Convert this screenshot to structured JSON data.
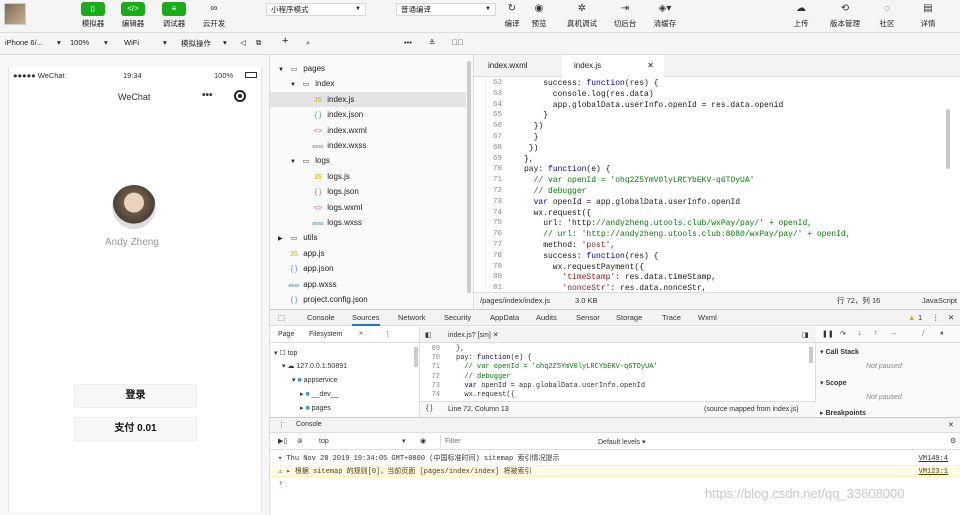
{
  "toolbar": {
    "buttons": [
      {
        "label": "模拟器",
        "icon": "mobile-icon"
      },
      {
        "label": "编辑器",
        "icon": "code-icon"
      },
      {
        "label": "调试器",
        "icon": "debug-icon"
      },
      {
        "label": "云开发",
        "icon": "cloud-icon"
      }
    ],
    "mode_select": "小程序模式",
    "compile_select": "普通编译",
    "actions": [
      {
        "label": "编译",
        "icon": "refresh-icon"
      },
      {
        "label": "预览",
        "icon": "eye-icon"
      },
      {
        "label": "真机调试",
        "icon": "bug-icon"
      },
      {
        "label": "切后台",
        "icon": "switch-icon"
      },
      {
        "label": "清缓存",
        "icon": "layers-icon"
      }
    ],
    "right_actions": [
      {
        "label": "上传",
        "icon": "upload-icon"
      },
      {
        "label": "版本管理",
        "icon": "version-icon"
      },
      {
        "label": "社区",
        "icon": "chat-icon"
      },
      {
        "label": "详情",
        "icon": "details-icon"
      }
    ]
  },
  "subbar": {
    "device": "iPhone 6/...",
    "zoom": "100%",
    "network": "WiFi",
    "operation": "模拟操作"
  },
  "phone": {
    "carrier": "●●●●● WeChat",
    "time": "19:34",
    "battery": "100%",
    "nav_title": "WeChat",
    "user_name": "Andy Zheng",
    "login_button": "登录",
    "pay_button": "支付 0.01"
  },
  "tree": [
    {
      "label": "pages",
      "indent": 0,
      "type": "folder",
      "open": true
    },
    {
      "label": "index",
      "indent": 1,
      "type": "folder",
      "open": true
    },
    {
      "label": "index.js",
      "indent": 2,
      "type": "js",
      "selected": true
    },
    {
      "label": "index.json",
      "indent": 2,
      "type": "json"
    },
    {
      "label": "index.wxml",
      "indent": 2,
      "type": "wxml"
    },
    {
      "label": "index.wxss",
      "indent": 2,
      "type": "wxss"
    },
    {
      "label": "logs",
      "indent": 1,
      "type": "folder",
      "open": true
    },
    {
      "label": "logs.js",
      "indent": 2,
      "type": "js"
    },
    {
      "label": "logs.json",
      "indent": 2,
      "type": "json"
    },
    {
      "label": "logs.wxml",
      "indent": 2,
      "type": "wxml"
    },
    {
      "label": "logs.wxss",
      "indent": 2,
      "type": "wxss"
    },
    {
      "label": "utils",
      "indent": 0,
      "type": "folder",
      "open": false
    },
    {
      "label": "app.js",
      "indent": 0,
      "type": "js"
    },
    {
      "label": "app.json",
      "indent": 0,
      "type": "json"
    },
    {
      "label": "app.wxss",
      "indent": 0,
      "type": "wxss"
    },
    {
      "label": "project.config.json",
      "indent": 0,
      "type": "json"
    }
  ],
  "editor": {
    "tabs": [
      "index.wxml",
      "index.js"
    ],
    "active_tab": "index.js",
    "lines": [
      {
        "n": "62",
        "code": "    success: function(res) {"
      },
      {
        "n": "63",
        "code": "      console.log(res.data)"
      },
      {
        "n": "64",
        "code": "      app.globalData.userInfo.openId = res.data.openid"
      },
      {
        "n": "65",
        "code": "    }"
      },
      {
        "n": "66",
        "code": "  })"
      },
      {
        "n": "67",
        "code": "  }"
      },
      {
        "n": "68",
        "code": " })"
      },
      {
        "n": "69",
        "code": "},"
      },
      {
        "n": "70",
        "code": "pay: function(e) {"
      },
      {
        "n": "71",
        "code": "  // var openId = 'ohq2Z5YmV0lyLRCYbEKV-q6TOyUA'"
      },
      {
        "n": "72",
        "code": "  // debugger"
      },
      {
        "n": "73",
        "code": "  var openId = app.globalData.userInfo.openId"
      },
      {
        "n": "74",
        "code": "  wx.request({"
      },
      {
        "n": "75",
        "code": "    url: 'http://andyzheng.utools.club/wxPay/pay/' + openId,"
      },
      {
        "n": "76",
        "code": "    // url: 'http://andyzheng.utools.club:8080/wxPay/pay/' + openId,"
      },
      {
        "n": "77",
        "code": "    method: 'post',"
      },
      {
        "n": "78",
        "code": "    success: function(res) {"
      },
      {
        "n": "79",
        "code": "      wx.requestPayment({"
      },
      {
        "n": "80",
        "code": "        'timeStamp': res.data.timeStamp,"
      },
      {
        "n": "81",
        "code": "        'nonceStr': res.data.nonceStr,"
      }
    ],
    "status_path": "/pages/index/index.js",
    "status_size": "3.0 KB",
    "status_pos": "行 72，列 16",
    "status_lang": "JavaScript"
  },
  "devtools": {
    "tabs": [
      "Console",
      "Sources",
      "Network",
      "Security",
      "AppData",
      "Audits",
      "Sensor",
      "Storage",
      "Trace",
      "Wxml"
    ],
    "active_tab": "Sources",
    "warn_count": "1",
    "left_tabs": [
      "Page",
      "Filesystem",
      "»"
    ],
    "tree": [
      "top",
      "127.0.0.1:50891",
      "appservice",
      "__dev__",
      "pages"
    ],
    "source_tab": "index.js? [sm]",
    "source_lines": [
      {
        "n": "69",
        "code": "},"
      },
      {
        "n": "70",
        "code": "pay: function(e) {"
      },
      {
        "n": "71",
        "code": "  // var openId = 'ohq2Z5YmV0lyLRCYbEKV-q6TOyUA'"
      },
      {
        "n": "72",
        "code": "  // debugger"
      },
      {
        "n": "73",
        "code": "  var openId = app.globalData.userInfo.openId"
      },
      {
        "n": "74",
        "code": "  wx.request({"
      }
    ],
    "source_status": "Line 72, Column 13",
    "source_mapped": "(source mapped from index.js)",
    "right_sections": [
      {
        "title": "Call Stack",
        "body": "Not paused"
      },
      {
        "title": "Scope",
        "body": "Not paused"
      },
      {
        "title": "Breakpoints",
        "body": ""
      }
    ],
    "drawer_title": "Console",
    "context": "top",
    "filter_placeholder": "Filter",
    "levels": "Default levels ▾",
    "messages": [
      {
        "type": "info",
        "text": "▾ Thu Nov 28 2019 19:34:05 GMT+0800 (中国标准时间) sitemap 索引情况提示",
        "src": "VM149:4"
      },
      {
        "type": "warn",
        "text": "⚠ ▸ 根据 sitemap 的规则[0]，当前页面 [pages/index/index] 将被索引",
        "src": "VM123:1"
      }
    ],
    "prompt": "›"
  },
  "watermark": "https://blog.csdn.net/qq_33608000"
}
